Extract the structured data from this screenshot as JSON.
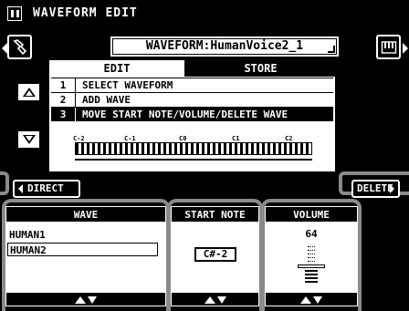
{
  "titlebar": {
    "title": "WAVEFORM EDIT"
  },
  "waveform": {
    "label": "WAVEFORM:HumanVoice2_1"
  },
  "tabs": [
    {
      "label": "EDIT",
      "active": true
    },
    {
      "label": "STORE",
      "active": false
    }
  ],
  "menu": {
    "items": [
      {
        "num": "1",
        "label": "SELECT WAVEFORM",
        "selected": false
      },
      {
        "num": "2",
        "label": "ADD WAVE",
        "selected": false
      },
      {
        "num": "3",
        "label": "MOVE START NOTE/VOLUME/DELETE WAVE",
        "selected": true
      }
    ]
  },
  "keyboard": {
    "octave_labels": [
      "C-2",
      "C-1",
      "C0",
      "C1",
      "C2"
    ]
  },
  "buttons": {
    "direct": "DIRECT",
    "delete": "DELETE"
  },
  "wave_panel": {
    "header": "WAVE",
    "items": [
      "HUMAN1",
      "HUMAN2"
    ],
    "selected": "HUMAN2"
  },
  "note_panel": {
    "header": "START NOTE",
    "value": "C#-2"
  },
  "volume_panel": {
    "header": "VOLUME",
    "value": "64"
  },
  "icons": {
    "title": "grid-icon",
    "left_tool": "guitar-hand-icon",
    "right_tool": "piano-icon",
    "scroll_up": "triangle-up-icon",
    "scroll_down": "triangle-down-icon",
    "panel_arrows": "up-down-arrows-icon"
  },
  "colors": {
    "background": "#000000",
    "foreground": "#ffffff",
    "hardware_frame": "#8a8a8a"
  }
}
